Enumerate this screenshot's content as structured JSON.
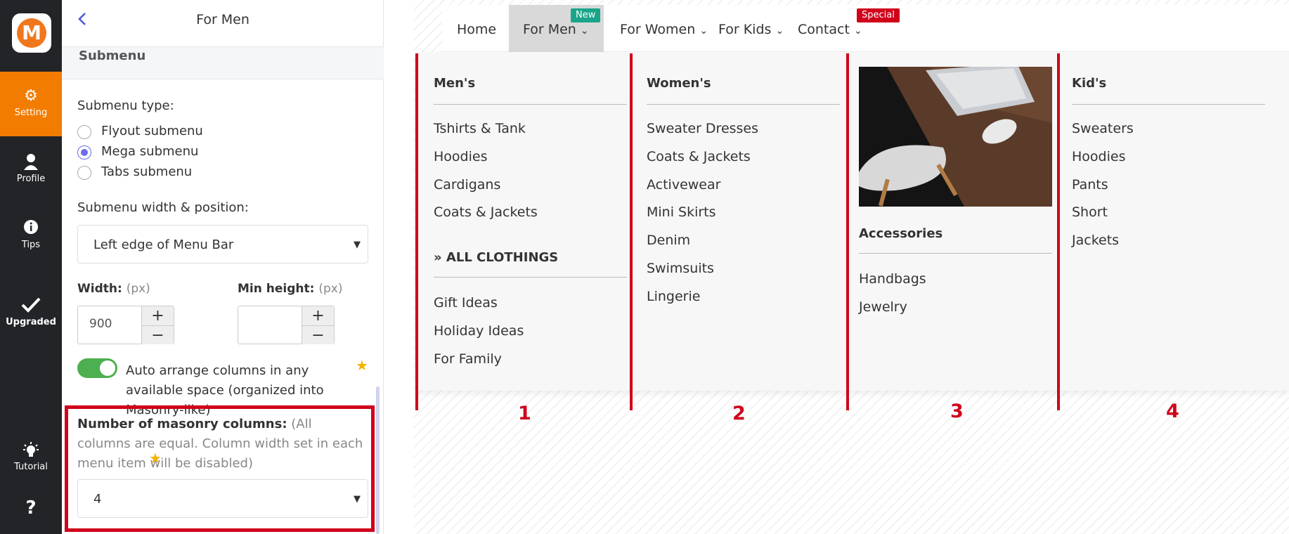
{
  "sidebar": {
    "logo_letter": "M",
    "items": [
      {
        "label": "Setting",
        "icon": "gear-icon",
        "active": true
      },
      {
        "label": "Profile",
        "icon": "user-icon"
      },
      {
        "label": "Tips",
        "icon": "info-icon"
      },
      {
        "label": "Upgraded",
        "icon": "check-icon"
      },
      {
        "label": "Tutorial",
        "icon": "bulb-icon"
      },
      {
        "label": "",
        "icon": "question-icon"
      }
    ],
    "accent": "#f27c00"
  },
  "panel": {
    "title": "For Men",
    "section": "Submenu",
    "submenu_type_label": "Submenu type:",
    "options": [
      "Flyout submenu",
      "Mega submenu",
      "Tabs submenu"
    ],
    "selected_option": "Mega submenu",
    "width_position_label": "Submenu width & position:",
    "width_position_value": "Left edge of Menu Bar",
    "width_label": "Width:",
    "width_unit": "(px)",
    "width_value": "900",
    "min_height_label": "Min height:",
    "min_height_unit": "(px)",
    "min_height_value": "",
    "auto_arrange_text": "Auto arrange columns in any available space (organized into Masonry-like)",
    "auto_arrange_on": true,
    "masonry_label": "Number of masonry columns:",
    "masonry_note": "(All columns are equal. Column width set in each menu item will be disabled)",
    "masonry_value": "4"
  },
  "preview": {
    "nav": [
      {
        "label": "Home"
      },
      {
        "label": "For Men",
        "badge": "New",
        "badge_color": "#1aa58a",
        "active": true
      },
      {
        "label": "For Women"
      },
      {
        "label": "For Kids"
      },
      {
        "label": "Contact",
        "badge": "Special",
        "badge_color": "#d0021b"
      }
    ],
    "columns": [
      {
        "heading": "Men's",
        "links": [
          "Tshirts & Tank",
          "Hoodies",
          "Cardigans",
          "Coats & Jackets"
        ],
        "subheading": "ALL CLOTHINGS",
        "sublinks": [
          "Gift Ideas",
          "Holiday Ideas",
          "For Family"
        ]
      },
      {
        "heading": "Women's",
        "links": [
          "Sweater Dresses",
          "Coats & Jackets",
          "Activewear",
          "Mini Skirts",
          "Denim",
          "Swimsuits",
          "Lingerie"
        ]
      },
      {
        "heading": "Accessories",
        "links": [
          "Handbags",
          "Jewelry"
        ]
      },
      {
        "heading": "Kid's",
        "links": [
          "Sweaters",
          "Hoodies",
          "Pants",
          "Short",
          "Jackets"
        ]
      }
    ],
    "column_numbers": [
      "1",
      "2",
      "3",
      "4"
    ]
  }
}
